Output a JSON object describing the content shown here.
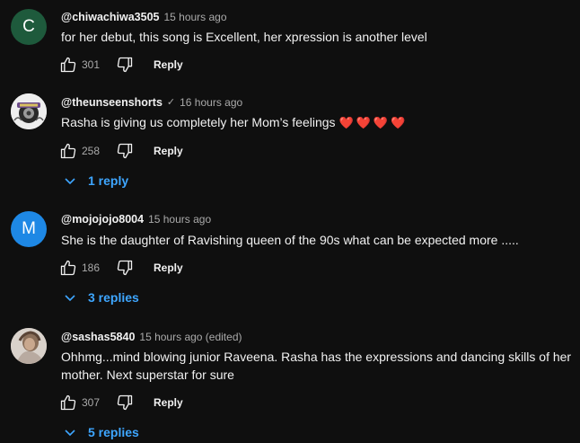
{
  "comments": [
    {
      "author": "@chiwachiwa3505",
      "time": "15 hours ago",
      "text": "for her debut, this song is Excellent, her xpression is another level",
      "likes": "301",
      "reply_label": "Reply",
      "avatar_letter": "C",
      "avatar_color": "#1e5a3c"
    },
    {
      "author": "@theunseenshorts",
      "verified_icon": "check-icon",
      "verified_mark": "✓",
      "time": "16 hours ago",
      "text": "Rasha is giving us completely her Mom’s feelings",
      "emoji": "❤️❤️❤️❤️",
      "likes": "258",
      "reply_label": "Reply",
      "replies_label": "1 reply"
    },
    {
      "author": "@mojojojo8004",
      "time": "15 hours ago",
      "text": "She is the daughter of Ravishing queen of the 90s what can be expected more .....",
      "likes": "186",
      "reply_label": "Reply",
      "replies_label": "3 replies",
      "avatar_letter": "M",
      "avatar_color": "#1e88e5"
    },
    {
      "author": "@sashas5840",
      "time": "15 hours ago (edited)",
      "text": "Ohhmg...mind blowing junior Raveena. Rasha has the expressions and dancing skills of her mother. Next superstar for sure",
      "likes": "307",
      "reply_label": "Reply",
      "replies_label": "5 replies"
    }
  ]
}
